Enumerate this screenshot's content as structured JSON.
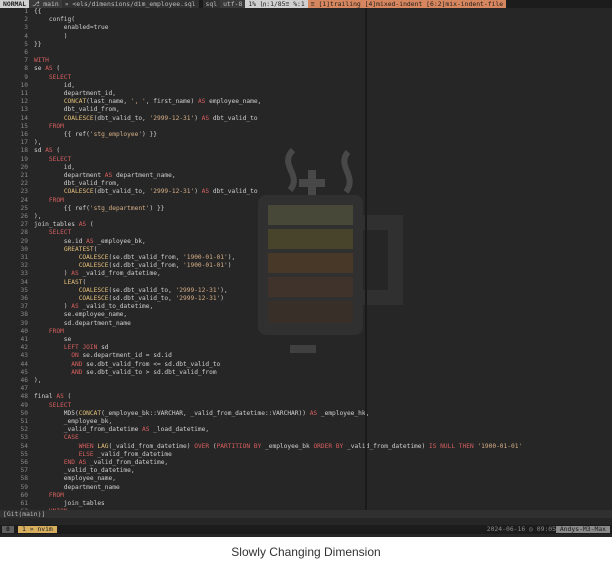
{
  "topbar": {
    "mode": "NORMAL",
    "branch": "⎇ main",
    "file": "» <els/dimensions/dim_employee.sql",
    "filetype": "sql",
    "encoding": "utf-8",
    "position": "1% ㏑:1/85≡ %:1",
    "warnings": "≡ [1]trailing [4]mixed-indent [6:2]mix-indent-file"
  },
  "code": [
    {
      "n": "1",
      "s": "",
      "c": "{{"
    },
    {
      "n": "2",
      "s": "",
      "c": "    config("
    },
    {
      "n": "3",
      "s": "",
      "c": "        enabled=true"
    },
    {
      "n": "4",
      "s": "",
      "c": "        )"
    },
    {
      "n": "5",
      "s": "",
      "c": "}}"
    },
    {
      "n": "6",
      "s": "",
      "c": ""
    },
    {
      "n": "7",
      "s": "",
      "c": "WITH"
    },
    {
      "n": "8",
      "s": "",
      "c": "se AS ("
    },
    {
      "n": "9",
      "s": "",
      "c": "    SELECT"
    },
    {
      "n": "10",
      "s": "",
      "c": "        id,"
    },
    {
      "n": "11",
      "s": "",
      "c": "        department_id,"
    },
    {
      "n": "12",
      "s": "",
      "c": "        CONCAT(last_name, ', ', first_name) AS employee_name,"
    },
    {
      "n": "13",
      "s": "",
      "c": "        dbt_valid_from,"
    },
    {
      "n": "14",
      "s": "",
      "c": "        COALESCE(dbt_valid_to, '2999-12-31') AS dbt_valid_to"
    },
    {
      "n": "15",
      "s": "",
      "c": "    FROM"
    },
    {
      "n": "16",
      "s": "",
      "c": "        {{ ref('stg_employee') }}"
    },
    {
      "n": "17",
      "s": "",
      "c": "),"
    },
    {
      "n": "18",
      "s": "",
      "c": "sd AS ("
    },
    {
      "n": "19",
      "s": "",
      "c": "    SELECT"
    },
    {
      "n": "20",
      "s": "",
      "c": "        id,"
    },
    {
      "n": "21",
      "s": "",
      "c": "        department AS department_name,"
    },
    {
      "n": "22",
      "s": "",
      "c": "        dbt_valid_from,"
    },
    {
      "n": "23",
      "s": "",
      "c": "        COALESCE(dbt_valid_to, '2999-12-31') AS dbt_valid_to"
    },
    {
      "n": "24",
      "s": "",
      "c": "    FROM"
    },
    {
      "n": "25",
      "s": "",
      "c": "        {{ ref('stg_department') }}"
    },
    {
      "n": "26",
      "s": "",
      "c": "),"
    },
    {
      "n": "27",
      "s": "",
      "c": "join_tables AS ("
    },
    {
      "n": "28",
      "s": "",
      "c": "    SELECT"
    },
    {
      "n": "29",
      "s": "",
      "c": "        se.id AS _employee_bk,"
    },
    {
      "n": "30",
      "s": "",
      "c": "        GREATEST("
    },
    {
      "n": "31",
      "s": "",
      "c": "            COALESCE(se.dbt_valid_from, '1900-01-01'),"
    },
    {
      "n": "32",
      "s": "",
      "c": "            COALESCE(sd.dbt_valid_from, '1900-01-01')"
    },
    {
      "n": "33",
      "s": "",
      "c": "        ) AS _valid_from_datetime,"
    },
    {
      "n": "34",
      "s": "",
      "c": "        LEAST("
    },
    {
      "n": "35",
      "s": "",
      "c": "            COALESCE(se.dbt_valid_to, '2999-12-31'),"
    },
    {
      "n": "36",
      "s": "",
      "c": "            COALESCE(sd.dbt_valid_to, '2999-12-31')"
    },
    {
      "n": "37",
      "s": "",
      "c": "        ) AS _valid_to_datetime,"
    },
    {
      "n": "38",
      "s": "",
      "c": "        se.employee_name,"
    },
    {
      "n": "39",
      "s": "",
      "c": "        sd.department_name"
    },
    {
      "n": "40",
      "s": "",
      "c": "    FROM"
    },
    {
      "n": "41",
      "s": "",
      "c": "        se"
    },
    {
      "n": "42",
      "s": "",
      "c": "        LEFT JOIN sd"
    },
    {
      "n": "43",
      "s": "",
      "c": "          ON se.department_id = sd.id"
    },
    {
      "n": "44",
      "s": "",
      "c": "          AND se.dbt_valid_from <= sd.dbt_valid_to"
    },
    {
      "n": "45",
      "s": "",
      "c": "          AND se.dbt_valid_to > sd.dbt_valid_from"
    },
    {
      "n": "46",
      "s": "",
      "c": "),"
    },
    {
      "n": "47",
      "s": "",
      "c": ""
    },
    {
      "n": "48",
      "s": "",
      "c": "final AS ("
    },
    {
      "n": "49",
      "s": "",
      "c": "    SELECT"
    },
    {
      "n": "50",
      "s": "",
      "c": "        MD5(CONCAT(_employee_bk::VARCHAR, _valid_from_datetime::VARCHAR)) AS _employee_hk,"
    },
    {
      "n": "51",
      "s": "",
      "c": "        _employee_bk,"
    },
    {
      "n": "52",
      "s": "",
      "c": "        _valid_from_datetime AS _load_datetime,"
    },
    {
      "n": "53",
      "s": "",
      "c": "        CASE"
    },
    {
      "n": "54",
      "s": "",
      "c": "            WHEN LAG(_valid_from_datetime) OVER (PARTITION BY _employee_bk ORDER BY _valid_from_datetime) IS NULL THEN '1900-01-01'"
    },
    {
      "n": "55",
      "s": "",
      "c": "            ELSE _valid_from_datetime"
    },
    {
      "n": "56",
      "s": "",
      "c": "        END AS _valid_from_datetime,"
    },
    {
      "n": "57",
      "s": "",
      "c": "        _valid_to_datetime,"
    },
    {
      "n": "58",
      "s": "",
      "c": "        employee_name,"
    },
    {
      "n": "59",
      "s": "",
      "c": "        department_name"
    },
    {
      "n": "60",
      "s": "",
      "c": "    FROM"
    },
    {
      "n": "61",
      "s": "",
      "c": "        join_tables"
    },
    {
      "n": "62",
      "s": "",
      "c": "    UNION"
    }
  ],
  "gitline": "[Git(main)]",
  "tmux": {
    "window_index": "0",
    "current_window": "1 » nvim",
    "datetime": "2024-06-16 ◷ 09:05",
    "host": "Andys-M3-Max"
  },
  "caption": "Slowly Changing Dimension",
  "colors": {
    "background": "#262626",
    "keyword": "#d75f5f",
    "function": "#e5c07b",
    "string": "#d7af87"
  }
}
